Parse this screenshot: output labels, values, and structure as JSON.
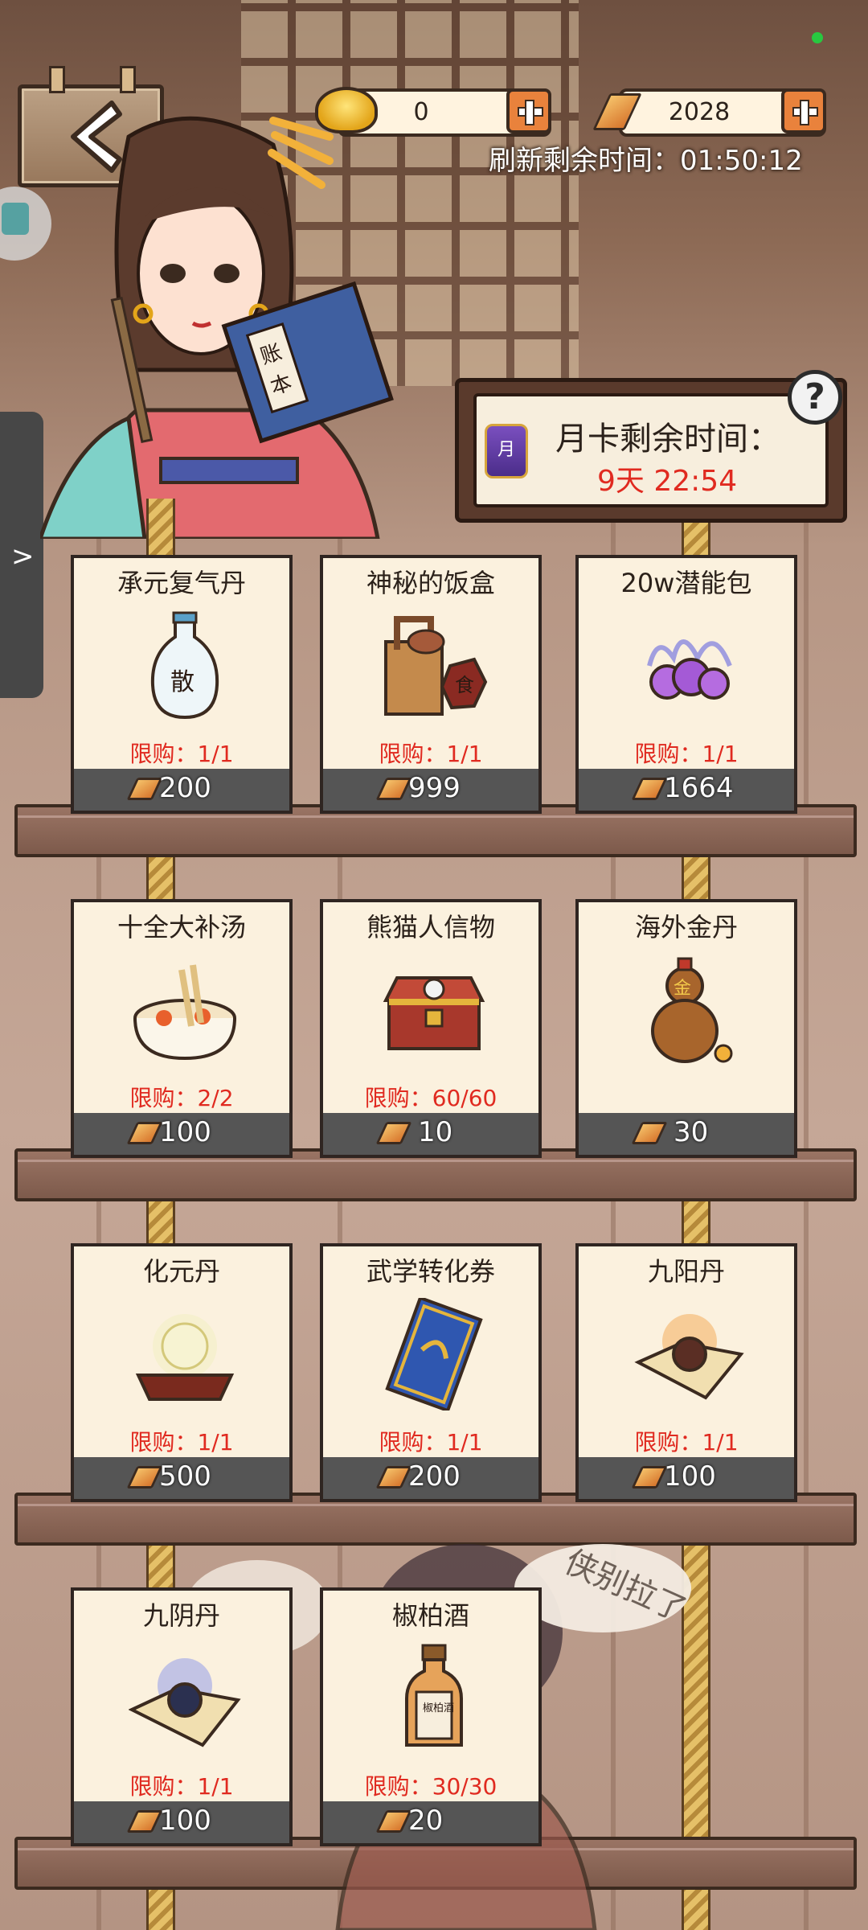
{
  "top": {
    "gold_ingot_value": "0",
    "gold_bar_value": "2028",
    "refresh_label": "刷新剩余时间：",
    "refresh_time": "01:50:12"
  },
  "character": {
    "book_text_1": "账",
    "book_text_2": "本"
  },
  "month_card": {
    "title": "月卡剩余时间：",
    "remaining": "9天 22:54",
    "badge_text": "月",
    "help": "?"
  },
  "shop": {
    "items": [
      {
        "name": "承元复气丹",
        "limit": "限购：1/1",
        "price": "200",
        "icon": "medicine-bottle-icon"
      },
      {
        "name": "神秘的饭盒",
        "limit": "限购：1/1",
        "price": "999",
        "icon": "food-box-icon"
      },
      {
        "name": "20w潜能包",
        "limit": "限购：1/1",
        "price": "1664",
        "icon": "potential-orbs-icon"
      },
      {
        "name": "十全大补汤",
        "limit": "限购：2/2",
        "price": "100",
        "icon": "soup-bowl-icon"
      },
      {
        "name": "熊猫人信物",
        "limit": "限购：60/60",
        "price": "10",
        "icon": "treasure-chest-icon"
      },
      {
        "name": "海外金丹",
        "limit": "",
        "price": "30",
        "icon": "gourd-icon"
      },
      {
        "name": "化元丹",
        "limit": "限购：1/1",
        "price": "500",
        "icon": "pearl-pedestal-icon"
      },
      {
        "name": "武学转化券",
        "limit": "限购：1/1",
        "price": "200",
        "icon": "ticket-icon"
      },
      {
        "name": "九阳丹",
        "limit": "限购：1/1",
        "price": "100",
        "icon": "yang-pill-icon"
      },
      {
        "name": "九阴丹",
        "limit": "限购：1/1",
        "price": "100",
        "icon": "yin-pill-icon"
      },
      {
        "name": "椒柏酒",
        "limit": "限购：30/30",
        "price": "20",
        "icon": "wine-bottle-icon"
      }
    ],
    "icon_texts": {
      "bottle": "散",
      "box": "食",
      "wine": "椒柏酒",
      "gourd": "金"
    }
  },
  "speech": "侠别拉了",
  "colors": {
    "limit_red": "#e02a20",
    "price_bar": "#555555",
    "card_bg": "#fbf1de"
  }
}
